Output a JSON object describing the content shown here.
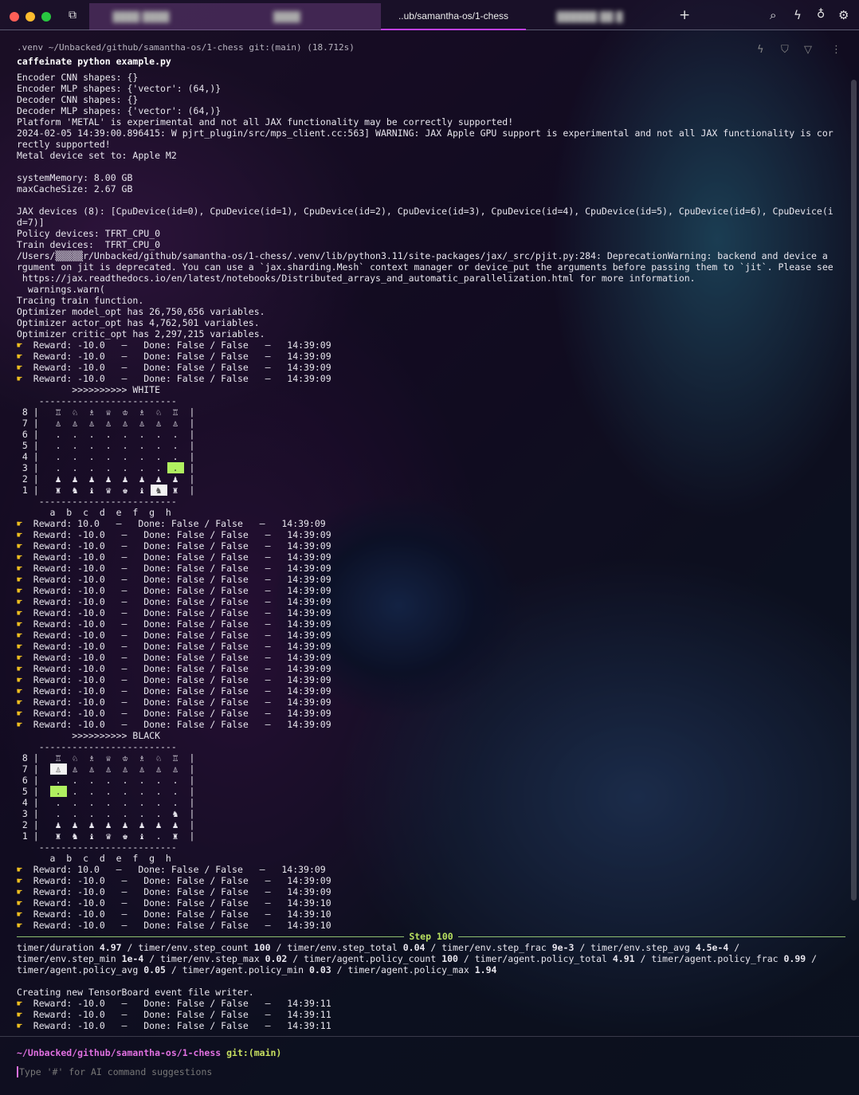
{
  "tabs": {
    "tab1": "████ ████",
    "tab2": "████",
    "active": "..ub/samantha-os/1-chess",
    "tab4": "██████ ██ █",
    "new": "+"
  },
  "block": {
    "header": ".venv ~/Unbacked/github/samantha-os/1-chess git:(main) (18.712s)",
    "command": "caffeinate python example.py"
  },
  "lines": [
    {
      "t": "Encoder CNN shapes: {}"
    },
    {
      "t": "Encoder MLP shapes: {'vector': (64,)}"
    },
    {
      "t": "Decoder CNN shapes: {}"
    },
    {
      "t": "Decoder MLP shapes: {'vector': (64,)}"
    },
    {
      "t": "Platform 'METAL' is experimental and not all JAX functionality may be correctly supported!"
    },
    {
      "t": "2024-02-05 14:39:00.896415: W pjrt_plugin/src/mps_client.cc:563] WARNING: JAX Apple GPU support is experimental and not all JAX functionality is cor"
    },
    {
      "t": "rectly supported!"
    },
    {
      "t": "Metal device set to: Apple M2"
    },
    {
      "t": ""
    },
    {
      "t": "systemMemory: 8.00 GB"
    },
    {
      "t": "maxCacheSize: 2.67 GB"
    },
    {
      "t": ""
    },
    {
      "t": "JAX devices (8): [CpuDevice(id=0), CpuDevice(id=1), CpuDevice(id=2), CpuDevice(id=3), CpuDevice(id=4), CpuDevice(id=5), CpuDevice(id=6), CpuDevice(i"
    },
    {
      "t": "d=7)]"
    },
    {
      "t": "Policy devices: TFRT_CPU_0"
    },
    {
      "t": "Train devices:  TFRT_CPU_0"
    },
    {
      "t": "/Users/▒▒▒▒▒r/Unbacked/github/samantha-os/1-chess/.venv/lib/python3.11/site-packages/jax/_src/pjit.py:284: DeprecationWarning: backend and device a"
    },
    {
      "t": "rgument on jit is deprecated. You can use a `jax.sharding.Mesh` context manager or device_put the arguments before passing them to `jit`. Please see"
    },
    {
      "t": " https://jax.readthedocs.io/en/latest/notebooks/Distributed_arrays_and_automatic_parallelization.html for more information."
    },
    {
      "t": "  warnings.warn("
    },
    {
      "t": "Tracing train function."
    },
    {
      "t": "Optimizer model_opt has 26,750,656 variables."
    },
    {
      "t": "Optimizer actor_opt has 4,762,501 variables."
    },
    {
      "t": "Optimizer critic_opt has 2,297,215 variables."
    },
    {
      "r": "Reward: -10.0   —   Done: False / False   —   14:39:09"
    },
    {
      "r": "Reward: -10.0   —   Done: False / False   —   14:39:09"
    },
    {
      "r": "Reward: -10.0   —   Done: False / False   —   14:39:09"
    },
    {
      "r": "Reward: -10.0   —   Done: False / False   —   14:39:09"
    },
    {
      "t": "          >>>>>>>>>> WHITE"
    },
    {
      "board": 0
    },
    {
      "r": "Reward: 10.0   —   Done: False / False   —   14:39:09"
    },
    {
      "r": "Reward: -10.0   —   Done: False / False   —   14:39:09"
    },
    {
      "r": "Reward: -10.0   —   Done: False / False   —   14:39:09"
    },
    {
      "r": "Reward: -10.0   —   Done: False / False   —   14:39:09"
    },
    {
      "r": "Reward: -10.0   —   Done: False / False   —   14:39:09"
    },
    {
      "r": "Reward: -10.0   —   Done: False / False   —   14:39:09"
    },
    {
      "r": "Reward: -10.0   —   Done: False / False   —   14:39:09"
    },
    {
      "r": "Reward: -10.0   —   Done: False / False   —   14:39:09"
    },
    {
      "r": "Reward: -10.0   —   Done: False / False   —   14:39:09"
    },
    {
      "r": "Reward: -10.0   —   Done: False / False   —   14:39:09"
    },
    {
      "r": "Reward: -10.0   —   Done: False / False   —   14:39:09"
    },
    {
      "r": "Reward: -10.0   —   Done: False / False   —   14:39:09"
    },
    {
      "r": "Reward: -10.0   —   Done: False / False   —   14:39:09"
    },
    {
      "r": "Reward: -10.0   —   Done: False / False   —   14:39:09"
    },
    {
      "r": "Reward: -10.0   —   Done: False / False   —   14:39:09"
    },
    {
      "r": "Reward: -10.0   —   Done: False / False   —   14:39:09"
    },
    {
      "r": "Reward: -10.0   —   Done: False / False   —   14:39:09"
    },
    {
      "r": "Reward: -10.0   —   Done: False / False   —   14:39:09"
    },
    {
      "r": "Reward: -10.0   —   Done: False / False   —   14:39:09"
    },
    {
      "t": "          >>>>>>>>>> BLACK"
    },
    {
      "board": 1
    },
    {
      "r": "Reward: 10.0   —   Done: False / False   —   14:39:09"
    },
    {
      "r": "Reward: -10.0   —   Done: False / False   —   14:39:09"
    },
    {
      "r": "Reward: -10.0   —   Done: False / False   —   14:39:09"
    },
    {
      "r": "Reward: -10.0   —   Done: False / False   —   14:39:10"
    },
    {
      "r": "Reward: -10.0   —   Done: False / False   —   14:39:10"
    },
    {
      "r": "Reward: -10.0   —   Done: False / False   —   14:39:10"
    },
    {
      "step": "Step 100"
    },
    {
      "timers": [
        [
          "timer/duration",
          "4.97"
        ],
        [
          "timer/env.step_count",
          "100"
        ],
        [
          "timer/env.step_total",
          "0.04"
        ],
        [
          "timer/env.step_frac",
          "9e-3"
        ],
        [
          "timer/env.step_avg",
          "4.5e-4"
        ]
      ]
    },
    {
      "timers": [
        [
          "timer/env.step_min",
          "1e-4"
        ],
        [
          "timer/env.step_max",
          "0.02"
        ],
        [
          "timer/agent.policy_count",
          "100"
        ],
        [
          "timer/agent.policy_total",
          "4.91"
        ],
        [
          "timer/agent.policy_frac",
          "0.99"
        ]
      ]
    },
    {
      "timers": [
        [
          "timer/agent.policy_avg",
          "0.05"
        ],
        [
          "timer/agent.policy_min",
          "0.03"
        ],
        [
          "timer/agent.policy_max",
          "1.94"
        ]
      ],
      "last": true
    },
    {
      "t": ""
    },
    {
      "t": "Creating new TensorBoard event file writer."
    },
    {
      "r": "Reward: -10.0   —   Done: False / False   —   14:39:11"
    },
    {
      "r": "Reward: -10.0   —   Done: False / False   —   14:39:11"
    },
    {
      "r": "Reward: -10.0   —   Done: False / False   —   14:39:11"
    }
  ],
  "boards": [
    {
      "rows": [
        [
          "♖",
          "♘",
          "♗",
          "♕",
          "♔",
          "♗",
          "♘",
          "♖"
        ],
        [
          "♙",
          "♙",
          "♙",
          "♙",
          "♙",
          "♙",
          "♙",
          "♙"
        ],
        [
          ".",
          ".",
          ".",
          ".",
          ".",
          ".",
          ".",
          "."
        ],
        [
          ".",
          ".",
          ".",
          ".",
          ".",
          ".",
          ".",
          "."
        ],
        [
          ".",
          ".",
          ".",
          ".",
          ".",
          ".",
          ".",
          "."
        ],
        [
          ".",
          ".",
          ".",
          ".",
          ".",
          ".",
          ".",
          "."
        ],
        [
          "♟",
          "♟",
          "♟",
          "♟",
          "♟",
          "♟",
          "♟",
          "♟"
        ],
        [
          "♜",
          "♞",
          "♝",
          "♛",
          "♚",
          "♝",
          "♞",
          "♜"
        ]
      ],
      "highlights": [
        {
          "rank": 3,
          "file": 7,
          "kind": "to"
        },
        {
          "rank": 1,
          "file": 6,
          "kind": "from"
        }
      ]
    },
    {
      "rows": [
        [
          "♖",
          "♘",
          "♗",
          "♕",
          "♔",
          "♗",
          "♘",
          "♖"
        ],
        [
          "♙",
          "♙",
          "♙",
          "♙",
          "♙",
          "♙",
          "♙",
          "♙"
        ],
        [
          ".",
          ".",
          ".",
          ".",
          ".",
          ".",
          ".",
          "."
        ],
        [
          ".",
          ".",
          ".",
          ".",
          ".",
          ".",
          ".",
          "."
        ],
        [
          ".",
          ".",
          ".",
          ".",
          ".",
          ".",
          ".",
          "."
        ],
        [
          ".",
          ".",
          ".",
          ".",
          ".",
          ".",
          ".",
          "♞"
        ],
        [
          "♟",
          "♟",
          "♟",
          "♟",
          "♟",
          "♟",
          "♟",
          "♟"
        ],
        [
          "♜",
          "♞",
          "♝",
          "♛",
          "♚",
          "♝",
          ".",
          "♜"
        ]
      ],
      "highlights": [
        {
          "rank": 5,
          "file": 0,
          "kind": "to"
        },
        {
          "rank": 7,
          "file": 0,
          "kind": "from"
        }
      ]
    }
  ],
  "files": [
    "a",
    "b",
    "c",
    "d",
    "e",
    "f",
    "g",
    "h"
  ],
  "ranks": [
    "8",
    "7",
    "6",
    "5",
    "4",
    "3",
    "2",
    "1"
  ],
  "prompt": {
    "path": "~/Unbacked/github/samantha-os/1-chess",
    "git": "git:(main)",
    "placeholder": "Type '#' for AI command suggestions"
  },
  "colors": {
    "to": "#b0f060",
    "from": "#f2f2f2",
    "path": "#e070e0",
    "git": "#c8e060",
    "tab_underline": "#c040f0"
  }
}
